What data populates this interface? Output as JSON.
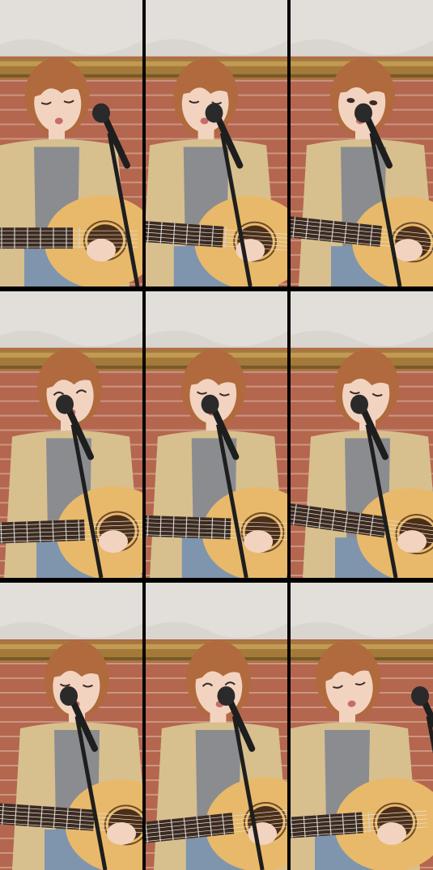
{
  "frames": [
    {
      "id": 1,
      "mood": "eyes-down-singing"
    },
    {
      "id": 2,
      "mood": "eyes-closed-singing"
    },
    {
      "id": 3,
      "mood": "looking-at-camera-singing"
    },
    {
      "id": 4,
      "mood": "smiling-at-camera"
    },
    {
      "id": 5,
      "mood": "eyes-closed-singing"
    },
    {
      "id": 6,
      "mood": "looking-down-singing"
    },
    {
      "id": 7,
      "mood": "eyes-closed-singing"
    },
    {
      "id": 8,
      "mood": "smiling-eyes-closed"
    },
    {
      "id": 9,
      "mood": "looking-down-playing"
    }
  ],
  "colors": {
    "wall_plaster": "#d9d6d0",
    "brick": "#b5664e",
    "frame_gold": "#a47a3a",
    "hair": "#b06a3e",
    "skin": "#f2d3c0",
    "cardigan": "#d7c08e",
    "top": "#8a8c90",
    "guitar": "#e8b96a",
    "fretboard": "#3a2a22",
    "mic": "#1e1e1e",
    "jeans": "#7f95ad"
  }
}
